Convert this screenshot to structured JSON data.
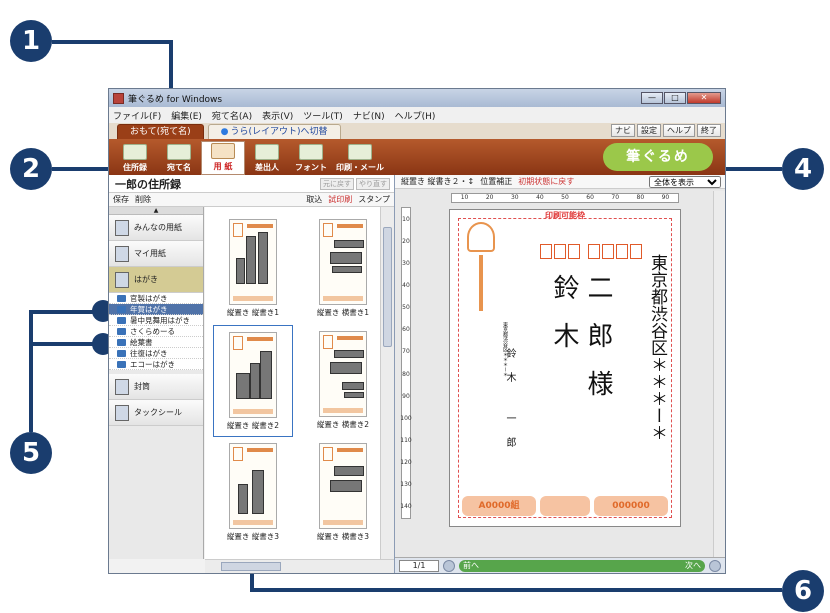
{
  "window": {
    "title": "筆ぐるめ for Windows",
    "min": "—",
    "max": "□",
    "close": "✕"
  },
  "menu": [
    "ファイル(F)",
    "編集(E)",
    "宛て名(A)",
    "表示(V)",
    "ツール(T)",
    "ナビ(N)",
    "ヘルプ(H)"
  ],
  "mode_tabs": {
    "active": "おもて(宛て名)",
    "inactive": "うら(レイアウト)へ切替"
  },
  "top_buttons": [
    "ナビ",
    "設定",
    "ヘルプ",
    "終了"
  ],
  "ribbon": [
    "住所録",
    "宛て名",
    "用 紙",
    "差出人",
    "フォント",
    "印刷・メール"
  ],
  "logo_text": "筆ぐるめ",
  "left_panel": {
    "title": "一郎の住所録",
    "undo": "元に戻す",
    "redo": "やり直す",
    "toolbar": {
      "save": "保存",
      "delete": "削除",
      "import": "取込",
      "trial_print": "試印刷",
      "stamp": "スタンプ"
    }
  },
  "categories": [
    {
      "label": "みんなの用紙"
    },
    {
      "label": "マイ用紙"
    },
    {
      "label": "はがき"
    }
  ],
  "subcategories": [
    "官製はがき",
    "年賀はがき",
    "暑中見舞用はがき",
    "さくらめーる",
    "絵葉書",
    "往復はがき",
    "エコーはがき"
  ],
  "categories_lower": [
    {
      "label": "封筒"
    },
    {
      "label": "タックシール"
    }
  ],
  "thumbnails": [
    {
      "label": "縦置き 縦書き1"
    },
    {
      "label": "縦置き 横書き1"
    },
    {
      "label": "縦置き 縦書き2"
    },
    {
      "label": "縦置き 横書き2"
    },
    {
      "label": "縦置き 縦書き3"
    },
    {
      "label": "縦置き 横書き3"
    }
  ],
  "right_panel": {
    "layout_label": "縦置き 縦書き２・↕",
    "position_fix": "位置補正",
    "reset": "初期状態に戻す",
    "zoom": "全体を表示",
    "printable": "印刷可能枠",
    "address_line": "東京都渋谷区＊＊＊ー＊",
    "recipient": "鈴木",
    "recipient2": "二郎様",
    "sender_addr": "東京都渋谷区＊＊＊ー＊",
    "sender_name": "鈴木 一郎",
    "lottery_left": "A0000組",
    "lottery_right": "000000",
    "ruler_h": [
      "10",
      "20",
      "30",
      "40",
      "50",
      "60",
      "70",
      "80",
      "90"
    ],
    "ruler_v": [
      "10",
      "20",
      "30",
      "40",
      "50",
      "60",
      "70",
      "80",
      "90",
      "100",
      "110",
      "120",
      "130",
      "140"
    ]
  },
  "nav": {
    "page": "1/1",
    "prev": "前へ",
    "next": "次へ"
  },
  "callouts": [
    "1",
    "2",
    "4",
    "5",
    "6"
  ]
}
